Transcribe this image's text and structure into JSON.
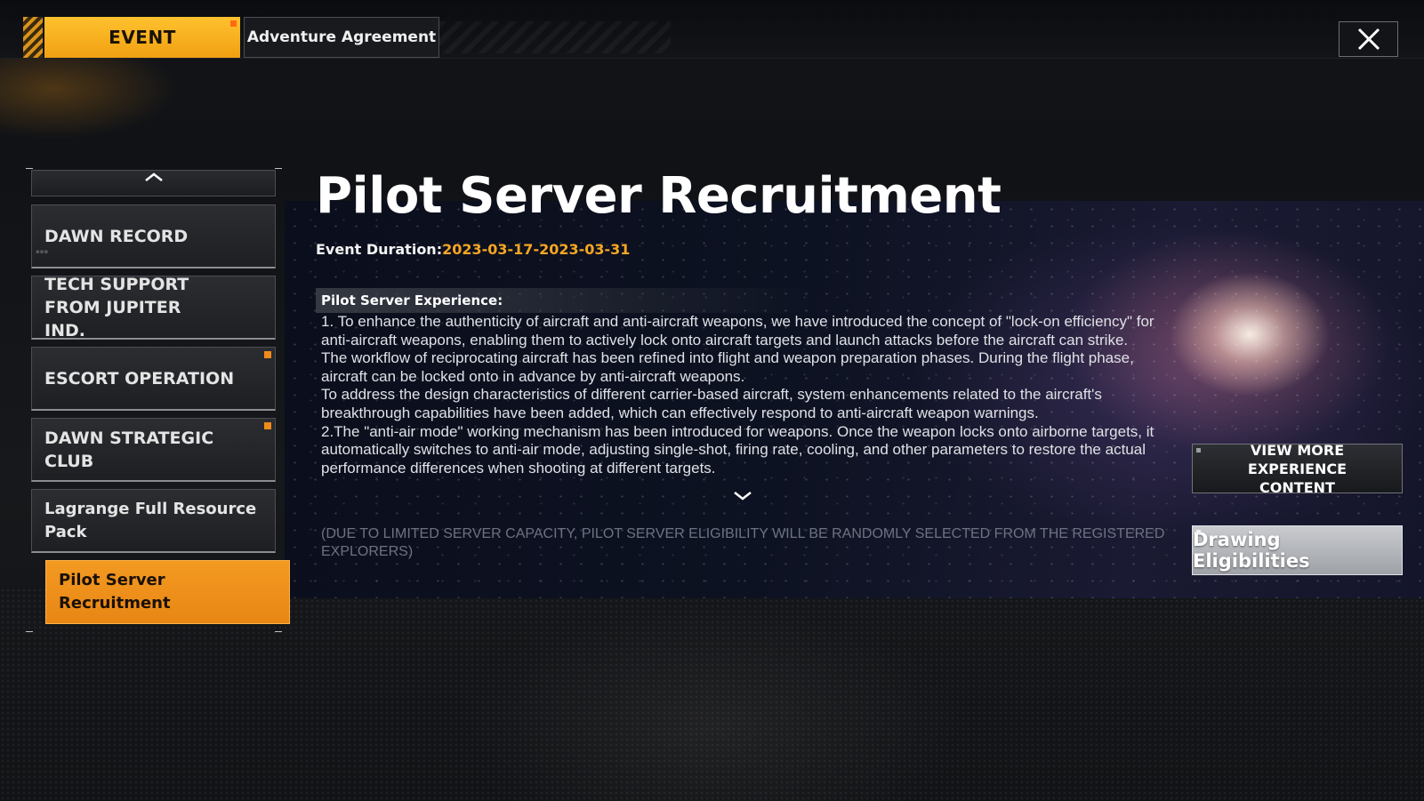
{
  "tabs": {
    "event_label": "EVENT",
    "adventure_label": "Adventure Agreement"
  },
  "sidebar": {
    "items": [
      {
        "label": "DAWN RECORD",
        "has_badge": false
      },
      {
        "label": "TECH SUPPORT FROM JUPITER IND.",
        "has_badge": false
      },
      {
        "label": "ESCORT OPERATION",
        "has_badge": true
      },
      {
        "label": "DAWN STRATEGIC CLUB",
        "has_badge": true
      },
      {
        "label": "Lagrange Full Resource Pack",
        "has_badge": false
      },
      {
        "label": "Pilot Server Recruitment",
        "has_badge": false,
        "selected": true
      }
    ]
  },
  "event": {
    "title": "Pilot Server Recruitment",
    "duration_label": "Event Duration:",
    "duration_value": "2023-03-17-2023-03-31",
    "section_heading": "Pilot Server Experience:",
    "paragraphs": [
      "1. To enhance the authenticity of aircraft and anti-aircraft weapons, we have introduced the concept of \"lock-on efficiency\" for anti-aircraft weapons, enabling them to actively lock onto aircraft targets and launch attacks before the aircraft can strike.",
      "The workflow of reciprocating aircraft has been refined into flight and weapon preparation phases. During the flight phase, aircraft can be locked onto in advance by anti-aircraft weapons.",
      "To address the design characteristics of different carrier-based aircraft, system enhancements related to the aircraft's breakthrough capabilities have been added, which can effectively respond to anti-aircraft weapon warnings.",
      "2.The \"anti-air mode\" working mechanism has been introduced for weapons. Once the weapon locks onto airborne targets, it automatically switches to anti-air mode, adjusting single-shot, firing rate, cooling, and other parameters to restore the actual performance differences when shooting at different targets."
    ],
    "notice": "(DUE TO LIMITED SERVER CAPACITY, PILOT SERVER ELIGIBILITY WILL BE RANDOMLY SELECTED FROM THE REGISTERED EXPLORERS)"
  },
  "buttons": {
    "view_more": "VIEW MORE EXPERIENCE CONTENT",
    "drawing": "Drawing Eligibilities"
  },
  "colors": {
    "accent_orange": "#f39a22",
    "tab_yellow": "#ffc22e",
    "date_orange": "#f6a623",
    "badge_orange": "#f08a1a"
  },
  "icons": {
    "close": "close-icon",
    "scroll_up": "chevron-up-icon",
    "scroll_down": "chevron-down-icon"
  }
}
